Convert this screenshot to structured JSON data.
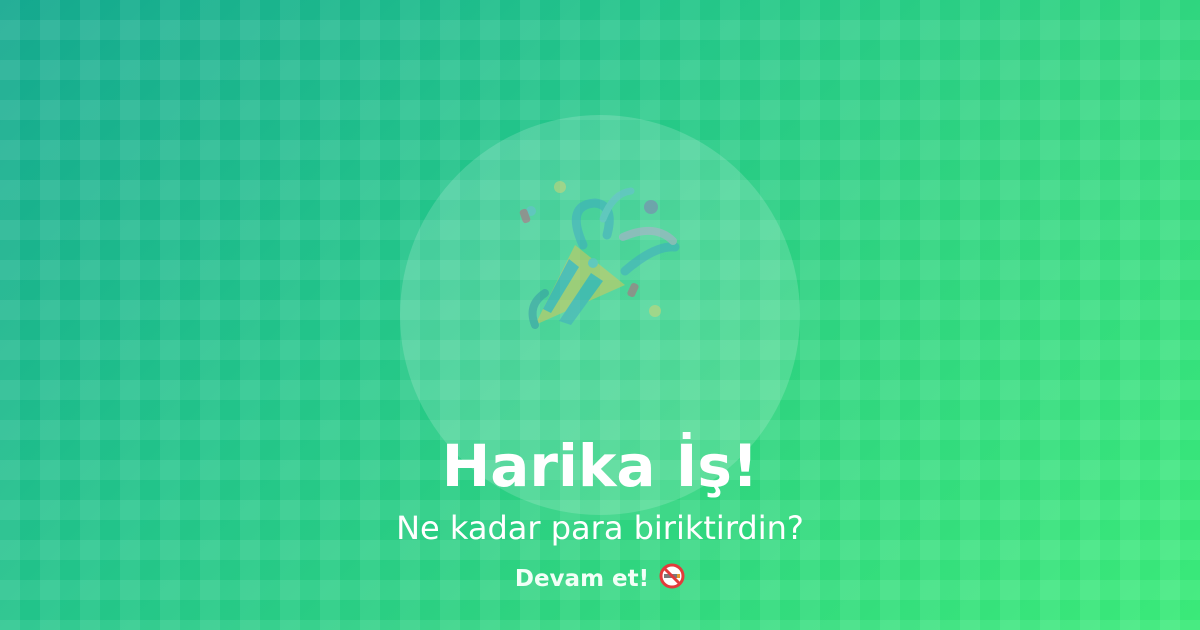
{
  "card": {
    "title": "Harika İş!",
    "subtitle": "Ne kadar para biriktirdin?",
    "cta_label": "Devam et!",
    "center_icon": "party-popper-icon",
    "cta_icon": "no-smoking-icon"
  },
  "colors": {
    "gradient_start": "#14a88f",
    "gradient_end": "#3aea79",
    "text": "#ffffff"
  }
}
